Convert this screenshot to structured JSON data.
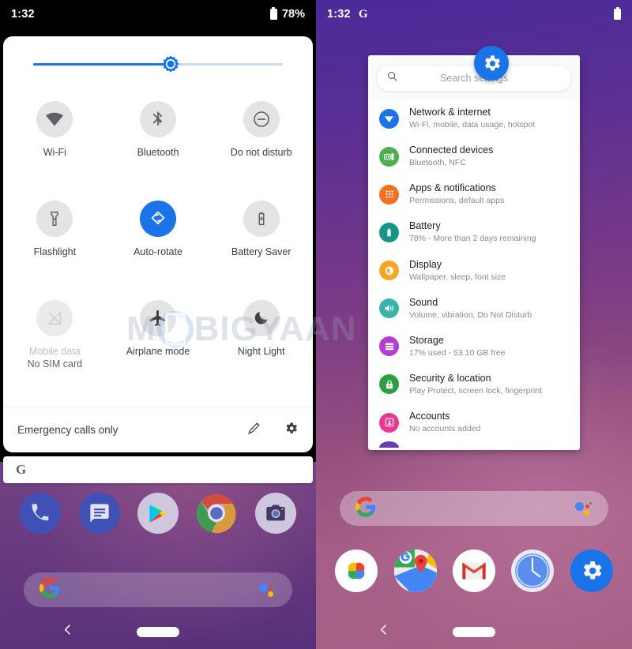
{
  "left_phone": {
    "status_bar": {
      "time": "1:32",
      "battery_percent": "78%",
      "battery_icon": "battery-icon"
    },
    "quick_settings": {
      "brightness": {
        "name": "brightness-slider",
        "value_percent": 55,
        "icon": "brightness-icon"
      },
      "tiles": [
        {
          "label": "Wi-Fi",
          "icon": "wifi-icon",
          "state": "off"
        },
        {
          "label": "Bluetooth",
          "icon": "bluetooth-icon",
          "state": "off"
        },
        {
          "label": "Do not disturb",
          "icon": "do-not-disturb-icon",
          "state": "off"
        },
        {
          "label": "Flashlight",
          "icon": "flashlight-icon",
          "state": "off"
        },
        {
          "label": "Auto-rotate",
          "icon": "auto-rotate-icon",
          "state": "on"
        },
        {
          "label": "Battery Saver",
          "icon": "battery-saver-icon",
          "state": "off"
        },
        {
          "label": "Mobile data",
          "sublabel": "No SIM card",
          "icon": "mobile-data-off-icon",
          "state": "disabled"
        },
        {
          "label": "Airplane mode",
          "icon": "airplane-icon",
          "state": "off"
        },
        {
          "label": "Night Light",
          "icon": "night-light-icon",
          "state": "off"
        }
      ],
      "footer": {
        "text": "Emergency calls only",
        "edit_icon": "pencil-icon",
        "settings_icon": "gear-icon"
      }
    },
    "search_widget": {
      "logo": "G",
      "name": "google-search-widget"
    },
    "dock_apps": [
      {
        "name": "phone-app-icon",
        "label": "Phone"
      },
      {
        "name": "messages-app-icon",
        "label": "Messages"
      },
      {
        "name": "play-store-app-icon",
        "label": "Play Store"
      },
      {
        "name": "chrome-app-icon",
        "label": "Chrome"
      },
      {
        "name": "camera-app-icon",
        "label": "Camera"
      }
    ],
    "search_pill": {
      "logo_icon": "google-g-icon",
      "assistant_icon": "google-assistant-icon"
    },
    "nav": {
      "back_icon": "back-icon",
      "home_pill": "home-pill"
    }
  },
  "right_phone": {
    "status_bar": {
      "time": "1:32",
      "google_icon": "google-g-icon",
      "battery_icon": "battery-icon"
    },
    "settings": {
      "floating_icon": "settings-gear-icon",
      "search": {
        "placeholder": "Search settings",
        "icon": "search-icon"
      },
      "items": [
        {
          "title": "Network & internet",
          "subtitle": "Wi-Fi, mobile, data usage, hotspot",
          "icon": "network-icon",
          "color": "#1a73e8"
        },
        {
          "title": "Connected devices",
          "subtitle": "Bluetooth, NFC",
          "icon": "connected-devices-icon",
          "color": "#4caf50"
        },
        {
          "title": "Apps & notifications",
          "subtitle": "Permissions, default apps",
          "icon": "apps-icon",
          "color": "#f4701f"
        },
        {
          "title": "Battery",
          "subtitle": "78% - More than 2 days remaining",
          "icon": "battery-icon",
          "color": "#159588"
        },
        {
          "title": "Display",
          "subtitle": "Wallpaper, sleep, font size",
          "icon": "display-icon",
          "color": "#f5a623"
        },
        {
          "title": "Sound",
          "subtitle": "Volume, vibration, Do Not Disturb",
          "icon": "sound-icon",
          "color": "#3bb3a8"
        },
        {
          "title": "Storage",
          "subtitle": "17% used - 53.10 GB free",
          "icon": "storage-icon",
          "color": "#b43dce"
        },
        {
          "title": "Security & location",
          "subtitle": "Play Protect, screen lock, fingerprint",
          "icon": "lock-icon",
          "color": "#2e9e45"
        },
        {
          "title": "Accounts",
          "subtitle": "No accounts added",
          "icon": "accounts-icon",
          "color": "#e8398f"
        }
      ]
    },
    "search_pill": {
      "logo_icon": "google-g-icon",
      "assistant_icon": "google-assistant-icon"
    },
    "dock_apps": [
      {
        "name": "photos-app-icon",
        "label": "Photos"
      },
      {
        "name": "maps-app-icon",
        "label": "Maps"
      },
      {
        "name": "gmail-app-icon",
        "label": "Gmail"
      },
      {
        "name": "clock-app-icon",
        "label": "Clock"
      },
      {
        "name": "settings-app-icon",
        "label": "Settings"
      }
    ],
    "nav": {
      "back_icon": "back-icon",
      "home_pill": "home-pill"
    }
  },
  "watermark": {
    "text_1": "M",
    "text_2": "BIGYAAN"
  },
  "colors": {
    "accent_blue": "#1a73e8",
    "tile_off": "#e4e4e4",
    "card_white": "#ffffff"
  }
}
